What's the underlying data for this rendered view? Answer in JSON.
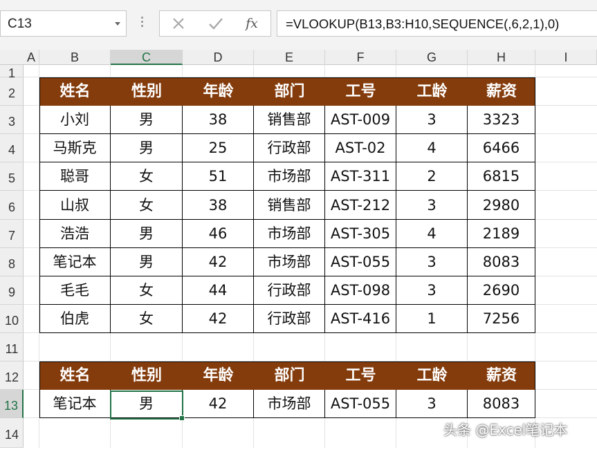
{
  "name_box": {
    "value": "C13"
  },
  "formula_bar": {
    "cancel_icon": "x-icon",
    "enter_icon": "check-icon",
    "fx_label": "fx",
    "formula": "=VLOOKUP(B13,B3:H10,SEQUENCE(,6,2,1),0)"
  },
  "columns": [
    "A",
    "B",
    "C",
    "D",
    "E",
    "F",
    "G",
    "H",
    "I"
  ],
  "rows": [
    "1",
    "2",
    "3",
    "4",
    "5",
    "6",
    "7",
    "8",
    "9",
    "10",
    "11",
    "12",
    "13",
    "14"
  ],
  "active_cell": {
    "column": "C",
    "row": "13"
  },
  "main_table": {
    "headers": [
      "姓名",
      "性别",
      "年龄",
      "部门",
      "工号",
      "工龄",
      "薪资"
    ],
    "rows": [
      [
        "小刘",
        "男",
        "38",
        "销售部",
        "AST-009",
        "3",
        "3323"
      ],
      [
        "马斯克",
        "男",
        "25",
        "行政部",
        "AST-02",
        "4",
        "6466"
      ],
      [
        "聪哥",
        "女",
        "51",
        "市场部",
        "AST-311",
        "2",
        "6815"
      ],
      [
        "山叔",
        "女",
        "38",
        "销售部",
        "AST-212",
        "3",
        "2980"
      ],
      [
        "浩浩",
        "男",
        "46",
        "市场部",
        "AST-305",
        "4",
        "2189"
      ],
      [
        "笔记本",
        "男",
        "42",
        "市场部",
        "AST-055",
        "3",
        "8083"
      ],
      [
        "毛毛",
        "女",
        "44",
        "行政部",
        "AST-098",
        "3",
        "2690"
      ],
      [
        "伯虎",
        "女",
        "42",
        "行政部",
        "AST-416",
        "1",
        "7256"
      ]
    ]
  },
  "lookup_table": {
    "headers": [
      "姓名",
      "性别",
      "年龄",
      "部门",
      "工号",
      "工龄",
      "薪资"
    ],
    "row": [
      "笔记本",
      "男",
      "42",
      "市场部",
      "AST-055",
      "3",
      "8083"
    ]
  },
  "watermark": "头条 @Excel笔记本",
  "colors": {
    "header_fill": "#843c0c",
    "header_text": "#ffffff",
    "selection": "#217346"
  }
}
